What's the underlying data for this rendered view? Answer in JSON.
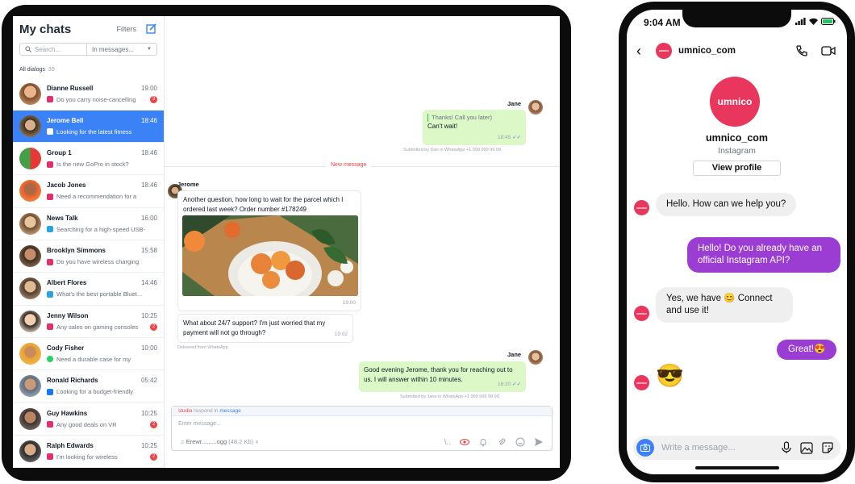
{
  "tablet": {
    "sidebar": {
      "title": "My chats",
      "filters_label": "Filters",
      "search_placeholder": "Search...",
      "scope_label": "In messages...",
      "all_dialogs_label": "All dialogs",
      "all_dialogs_count": "39",
      "dialogs": [
        {
          "name": "Dianne Russell",
          "time": "19:00",
          "preview": "Do you carry noise-cancelling",
          "source": "instagram",
          "badge": "3",
          "active": false
        },
        {
          "name": "Jerome Bell",
          "time": "18:46",
          "preview": "Looking for the latest fitness",
          "source": "instagram",
          "badge": "",
          "active": true
        },
        {
          "name": "Group 1",
          "time": "18:46",
          "preview": "Is the new GoPro in stock?",
          "source": "instagram",
          "badge": "",
          "active": false
        },
        {
          "name": "Jacob Jones",
          "time": "18:46",
          "preview": "Need a recommendation for a",
          "source": "instagram",
          "badge": "",
          "active": false
        },
        {
          "name": "News Talk",
          "time": "16:00",
          "preview": "Searching for a high-speed USB-",
          "source": "telegram",
          "badge": "",
          "active": false
        },
        {
          "name": "Brooklyn Simmons",
          "time": "15:58",
          "preview": "Do you have wireless charging",
          "source": "instagram",
          "badge": "",
          "active": false
        },
        {
          "name": "Albert Flores",
          "time": "14:46",
          "preview": "What's the best portable Bluet...",
          "source": "telegram",
          "badge": "",
          "active": false
        },
        {
          "name": "Jenny Wilson",
          "time": "10:25",
          "preview": "Any sales on gaming consoles",
          "source": "instagram",
          "badge": "2",
          "active": false
        },
        {
          "name": "Cody Fisher",
          "time": "10:00",
          "preview": "Need a durable case for my",
          "source": "whatsapp",
          "badge": "",
          "active": false
        },
        {
          "name": "Ronald Richards",
          "time": "05:42",
          "preview": "Looking for a budget-friendly",
          "source": "facebook",
          "badge": "",
          "active": false
        },
        {
          "name": "Guy Hawkins",
          "time": "10:25",
          "preview": "Any good deals on VR",
          "source": "instagram",
          "badge": "2",
          "active": false
        },
        {
          "name": "Ralph Edwards",
          "time": "10:25",
          "preview": "I'm looking for wireless",
          "source": "instagram",
          "badge": "2",
          "active": false
        }
      ]
    },
    "chat": {
      "msg1": {
        "sender": "Jane",
        "quote": "Thanks! Call you later)",
        "text": "Can't wait!",
        "time": "18:45",
        "note": "Submitted by Dan in WhatsApp +1 999 999 99 99"
      },
      "new_message_label": "New message",
      "msg2": {
        "sender": "Jerome",
        "text": "Another question, how long to wait for the parcel which I ordered last week?  Order number #178249",
        "time": "19:00"
      },
      "msg3": {
        "text": "What about 24/7 support? I'm just worried that my payment will not go through?",
        "time": "19:02",
        "note": "Delivered from WhatsApp"
      },
      "msg4": {
        "sender": "Jane",
        "text": "Good evening Jerome, thank you for reaching out to us. I will answer within 10 minutes.",
        "time": "18:30",
        "note": "Submitted by Jane in WhatsApp +1 999 999 99 99"
      },
      "composer": {
        "mode_word1": "studio",
        "mode_word2": "respond in",
        "mode_word3": "message",
        "placeholder": "Enter message...",
        "attachment_name": "Erewr.........ogg",
        "attachment_size": "(48.2 Kb)",
        "attachment_remove": "×"
      }
    }
  },
  "phone": {
    "status_time": "9:04 AM",
    "header_handle": "umnico_com",
    "profile_logo_text": "umnico",
    "profile_name": "umnico_com",
    "profile_platform": "Instagram",
    "view_profile_label": "View profile",
    "messages": [
      {
        "dir": "in",
        "text": "Hello. How can we help you?"
      },
      {
        "dir": "out",
        "text": "Hello! Do you already have an official Instagram API?"
      },
      {
        "dir": "in",
        "text": "Yes, we have 😊 Connect and use it!"
      },
      {
        "dir": "out",
        "text": "Great!😍"
      },
      {
        "dir": "in",
        "text": "😎"
      }
    ],
    "input_placeholder": "Write a message...",
    "colors": {
      "brand": "#e8365d",
      "outgoing": "#9b3dd3",
      "accent": "#3b82f6"
    }
  }
}
